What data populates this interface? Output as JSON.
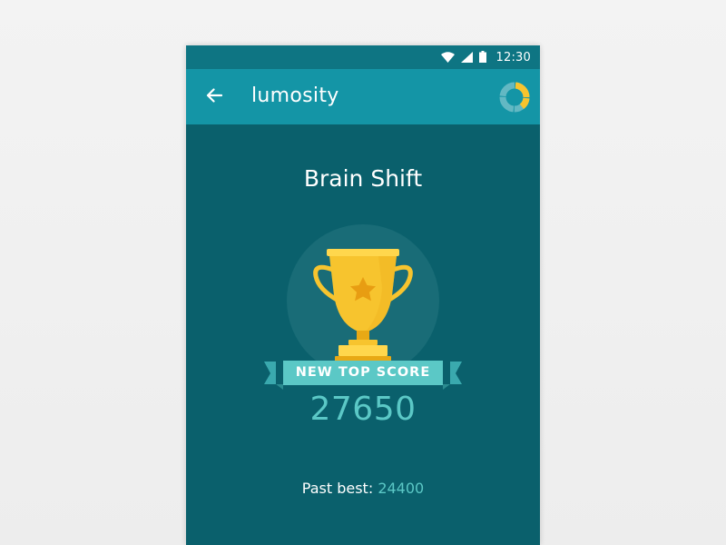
{
  "status_bar": {
    "time": "12:30",
    "icons": [
      "wifi-icon",
      "signal-icon",
      "battery-icon"
    ]
  },
  "app_bar": {
    "back_icon": "back-arrow-icon",
    "title": "lumosity",
    "progress_icon": "progress-ring-icon"
  },
  "game": {
    "title": "Brain Shift",
    "trophy_icon": "trophy-icon",
    "banner_label": "NEW TOP SCORE",
    "score": "27650",
    "past_best_label": "Past best:",
    "past_best_value": "24400"
  },
  "colors": {
    "background": "#0a606c",
    "app_bar": "#1495a6",
    "status_bar": "#0e7583",
    "accent_teal": "#5bc8c6",
    "trophy_gold": "#f7c42e"
  }
}
